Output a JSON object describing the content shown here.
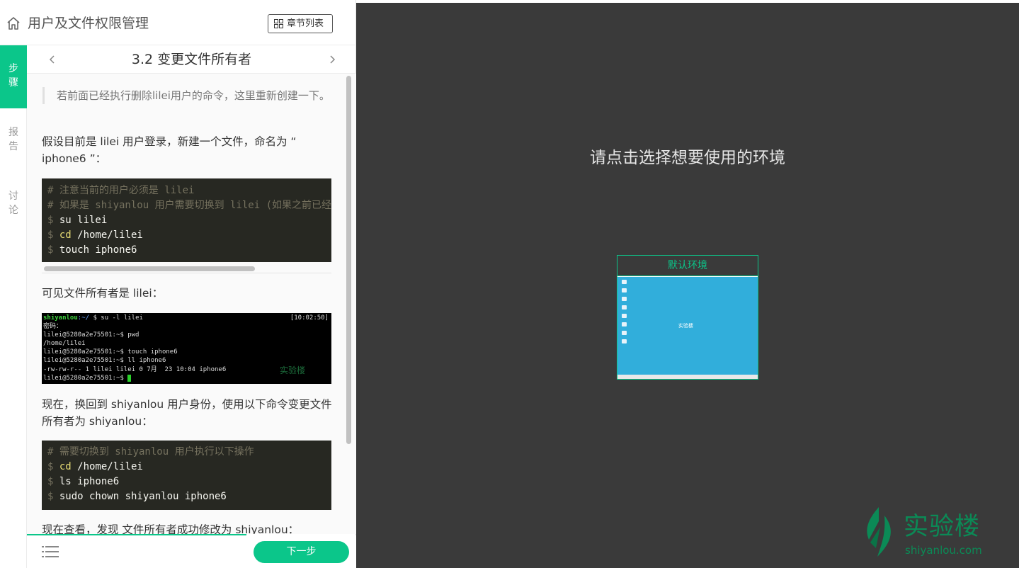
{
  "header": {
    "course_title": "用户及文件权限管理",
    "chapter_list_label": "章节列表"
  },
  "side_tabs": {
    "steps": [
      "步",
      "骤"
    ],
    "report": [
      "报",
      "告"
    ],
    "discuss": [
      "讨",
      "论"
    ]
  },
  "step": {
    "title": "3.2 变更文件所有者"
  },
  "content": {
    "note": "若前面已经执行删除lilei用户的命令，这里重新创建一下。",
    "para1": "假设目前是 lilei 用户登录，新建一个文件，命名为 “ iphone6 ”：",
    "code1": {
      "comment1": "# 注意当前的用户必须是 lilei",
      "comment2": "# 如果是 shiyanlou 用户需要切换到 lilei (如果之前已经删除需要重新创建)",
      "line3_prompt": "$ ",
      "line3_cmd": "su lilei",
      "line4_prompt": "$ ",
      "line4_kw": "cd",
      "line4_arg": " /home/lilei",
      "line5_prompt": "$ ",
      "line5_cmd": "touch iphone6"
    },
    "para2": "可见文件所有者是 lilei：",
    "terminal": {
      "l1_user": "shiyanlou",
      "l1_path": ":~/",
      "l1_cmd": " $ su -l lilei",
      "time": "[10:02:50]",
      "l2": "密码：",
      "l3": "lilei@5280a2e75501:~$ pwd",
      "l4": "/home/lilei",
      "l5": "lilei@5280a2e75501:~$ touch iphone6",
      "l6": "lilei@5280a2e75501:~$ ll iphone6",
      "l7": "-rw-rw-r-- 1 lilei lilei 0 7月  23 10:04 iphone6",
      "l8": "lilei@5280a2e75501:~$ ",
      "watermark": "实验楼"
    },
    "para3": "现在，换回到 shiyanlou 用户身份，使用以下命令变更文件所有者为 shiyanlou：",
    "code2": {
      "comment1": "# 需要切换到 shiyanlou 用户执行以下操作",
      "line2_prompt": "$ ",
      "line2_kw": "cd",
      "line2_arg": " /home/lilei",
      "line3_prompt": "$ ",
      "line3_cmd": "ls iphone6",
      "line4_prompt": "$ ",
      "line4_cmd": "sudo chown shiyanlou iphone6"
    },
    "para4": "现在查看，发现 文件所有者成功修改为 shiyanlou："
  },
  "footer": {
    "next_label": "下一步"
  },
  "right": {
    "prompt": "请点击选择想要使用的环境",
    "env_name": "默认环境",
    "env_logo": "实验楼",
    "brand_name": "实验楼",
    "brand_domain": "shiyanlou.com"
  },
  "colors": {
    "accent": "#0bc68a",
    "right_bg": "#3a3a3a",
    "code_bg": "#272822"
  }
}
